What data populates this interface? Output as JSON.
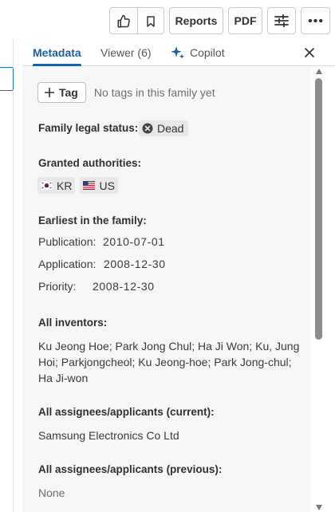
{
  "toolbar": {
    "like_icon": "thumbs-up-icon",
    "bookmark_icon": "bookmark-icon",
    "reports_label": "Reports",
    "pdf_label": "PDF",
    "settings_icon": "sliders-icon",
    "more_icon": "more-horizontal-icon"
  },
  "tabs": {
    "metadata": "Metadata",
    "viewer": "Viewer (6)",
    "copilot": "Copilot",
    "active": "metadata"
  },
  "tags": {
    "button_label": "Tag",
    "empty_text": "No tags in this family yet"
  },
  "legal_status": {
    "label": "Family legal status:",
    "value": "Dead"
  },
  "authorities": {
    "label": "Granted authorities:",
    "items": [
      {
        "code": "KR",
        "flag": "south-korea-flag"
      },
      {
        "code": "US",
        "flag": "united-states-flag"
      }
    ]
  },
  "earliest": {
    "label": "Earliest in the family:",
    "publication_label": "Publication:",
    "publication_date": "2010-07-01",
    "application_label": "Application:",
    "application_date": "2008-12-30",
    "priority_label": "Priority:",
    "priority_date": "2008-12-30"
  },
  "inventors": {
    "label": "All inventors:",
    "line1": "Ku Jeong Hoe; Park Jong Chul; Ha Ji Won; Ku, Jung",
    "line2": "Hoi; Parkjongcheol; Ku Jeong-hoe; Park Jong-chul;",
    "line3": "Ha Ji-won"
  },
  "assignees_current": {
    "label": "All assignees/applicants (current):",
    "value": "Samsung Electronics Co Ltd"
  },
  "assignees_previous": {
    "label": "All assignees/applicants (previous):",
    "value": "None"
  },
  "colors": {
    "accent": "#1f5fa0",
    "panel_bg": "#f7f7f7",
    "badge_bg": "#e8e8e8"
  }
}
